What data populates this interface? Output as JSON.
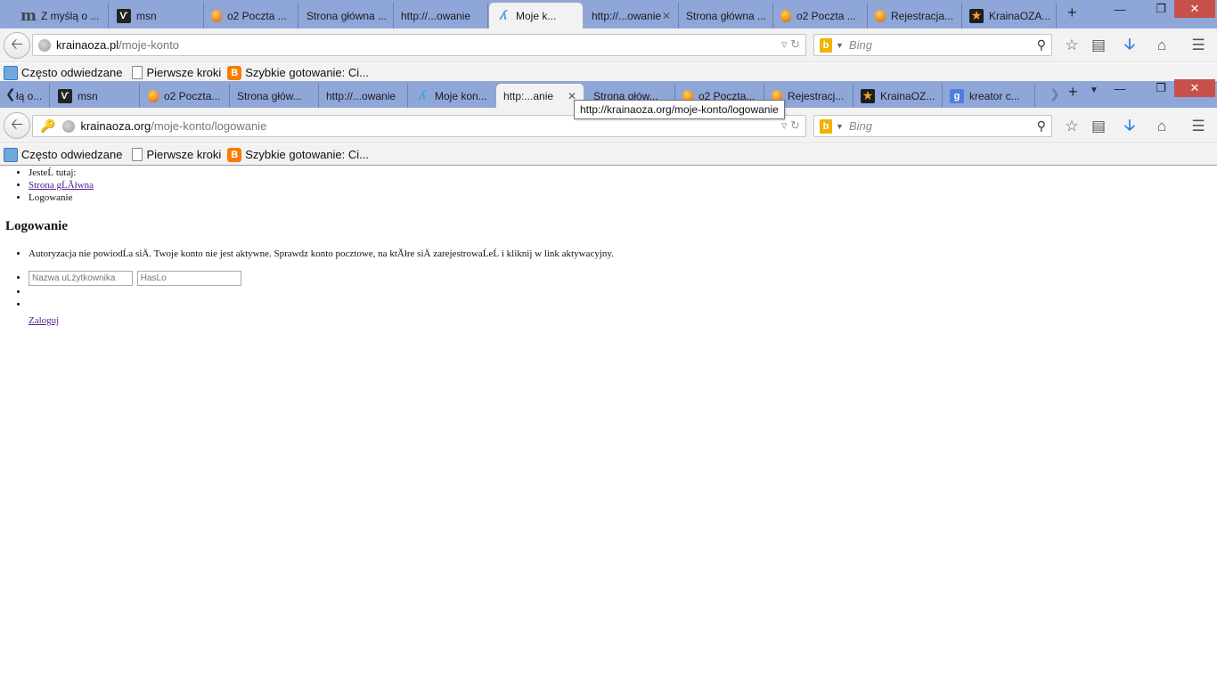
{
  "window1": {
    "tabs": [
      {
        "icon": "m-icon",
        "label": "Z myślą o ..."
      },
      {
        "icon": "msn-icon",
        "label": "msn"
      },
      {
        "icon": "o2-balloon-icon",
        "label": "o2 Poczta ..."
      },
      {
        "icon": "",
        "label": "Strona główna ..."
      },
      {
        "icon": "",
        "label": "http://...owanie"
      },
      {
        "icon": "krainaoza-icon",
        "label": "Moje k..."
      },
      {
        "icon": "",
        "label": "http://...owanie"
      },
      {
        "icon": "",
        "label": "Strona główna ..."
      },
      {
        "icon": "o2-balloon-icon",
        "label": "o2 Poczta ..."
      },
      {
        "icon": "o2-balloon-icon",
        "label": "Rejestracja..."
      },
      {
        "icon": "star-icon",
        "label": "KrainaOZA..."
      }
    ],
    "new_tab": "+",
    "url_domain": "krainaoza.pl",
    "url_path": "/moje-konto",
    "search_placeholder": "Bing"
  },
  "window2": {
    "tabs": [
      {
        "icon": "",
        "label": "łą o..."
      },
      {
        "icon": "msn-icon",
        "label": "msn"
      },
      {
        "icon": "o2-balloon-icon",
        "label": "o2 Poczta..."
      },
      {
        "icon": "",
        "label": "Strona głów..."
      },
      {
        "icon": "",
        "label": "http://...owanie"
      },
      {
        "icon": "krainaoza-icon",
        "label": "Moje kon..."
      },
      {
        "icon": "",
        "label": "http:...anie"
      },
      {
        "icon": "",
        "label": "Strona głów..."
      },
      {
        "icon": "o2-balloon-icon",
        "label": "o2 Poczta..."
      },
      {
        "icon": "o2-balloon-icon",
        "label": "Rejestracj..."
      },
      {
        "icon": "star-icon",
        "label": "KrainaOZ..."
      },
      {
        "icon": "google-icon",
        "label": "kreator c..."
      }
    ],
    "new_tab": "+",
    "url_domain": "krainaoza.org",
    "url_path": "/moje-konto/logowanie",
    "search_placeholder": "Bing",
    "tooltip": "http://krainaoza.org/moje-konto/logowanie"
  },
  "bookmarks": [
    {
      "icon": "often-visited-icon",
      "label": "Często odwiedzane"
    },
    {
      "icon": "page-icon",
      "label": "Pierwsze kroki"
    },
    {
      "icon": "blogger-icon",
      "label": "Szybkie gotowanie: Ci..."
    }
  ],
  "page": {
    "breadcrumb_prefix": "JesteĹ tutaj:",
    "breadcrumb_home": "Strona gĹĂłwna",
    "breadcrumb_current": "Logowanie",
    "title": "Logowanie",
    "error_message": "Autoryzacja nie powiodĹa siÄ. Twoje konto nie jest aktywne. Sprawdz konto pocztowe, na ktĂłre siÄ zarejestrowaĹeĹ i kliknij w link aktywacyjny.",
    "username_placeholder": "Nazwa uĹźytkownika",
    "password_placeholder": "HasĹo",
    "login_link": "Zaloguj"
  },
  "colors": {
    "tabstrip": "#8fa6d9",
    "toolbar": "#f2f2f2",
    "close_button": "#c7504a",
    "link_visited": "#551a8b",
    "download_accent": "#2a7de1"
  }
}
